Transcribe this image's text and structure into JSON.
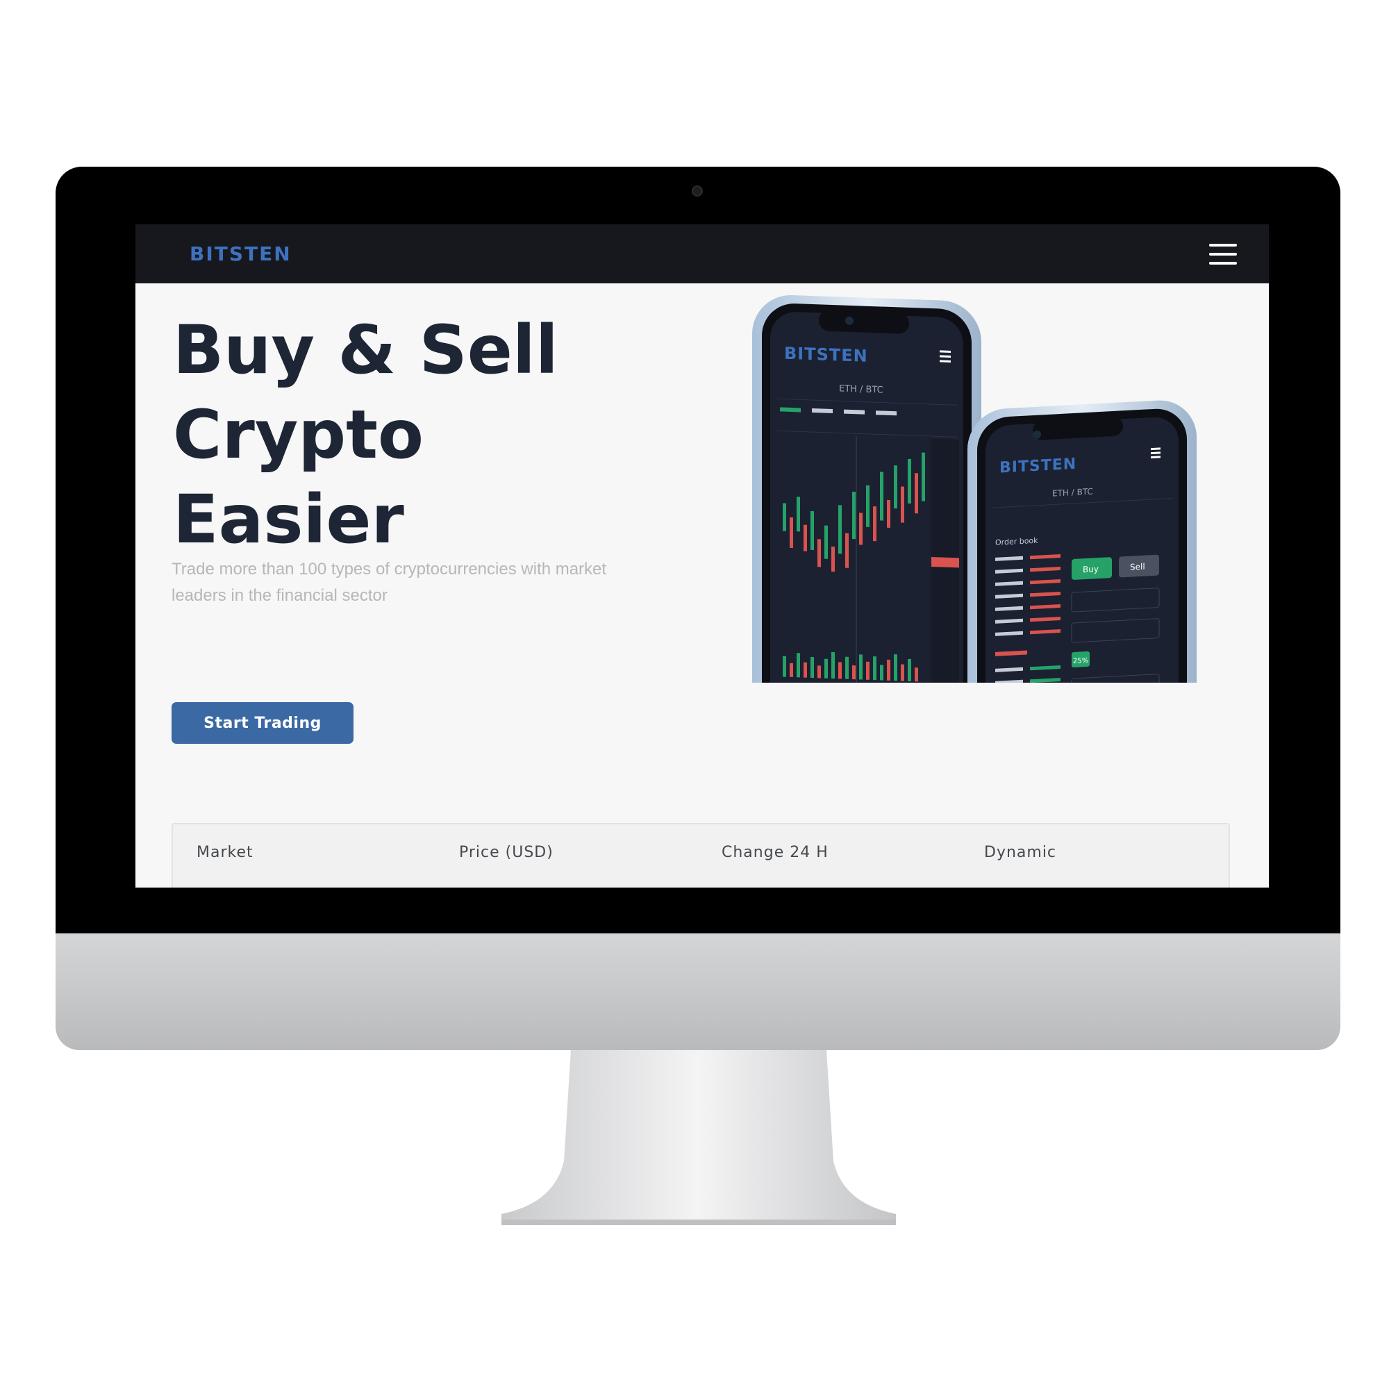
{
  "navbar": {
    "brand": "BITSTEN",
    "menu_icon": "hamburger-menu-icon"
  },
  "hero": {
    "title_lines": [
      "Buy & Sell",
      "Crypto",
      "Easier"
    ],
    "subtitle": "Trade more than 100 types of cryptocurrencies with market leaders in the financial sector",
    "cta_label": "Start Trading"
  },
  "market_table": {
    "columns": [
      "Market",
      "Price (USD)",
      "Change 24 H",
      "Dynamic"
    ]
  },
  "phone_mockups": {
    "brand": "BITSTEN",
    "pair": "ETH / BTC",
    "order_book_label": "Order book",
    "buy_label": "Buy",
    "sell_label": "Sell",
    "percent_badge": "25%"
  },
  "colors": {
    "brand_blue": "#3d72c0",
    "cta_blue": "#3a69a4",
    "navbar_bg": "#16181d",
    "title_color": "#1e2535",
    "buy_green": "#26a269",
    "sell_red": "#d9534f"
  }
}
